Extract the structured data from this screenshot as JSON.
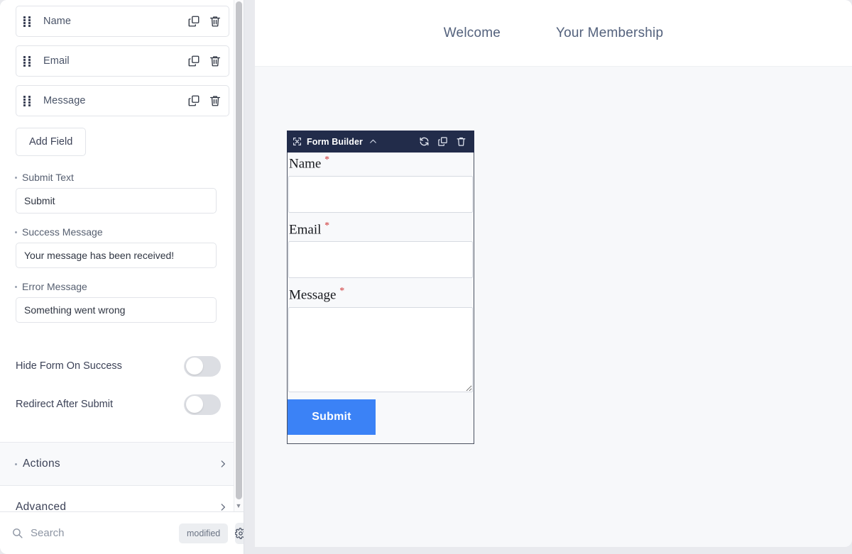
{
  "sidebar": {
    "fields": [
      {
        "label": "Name",
        "drag_icon": "drag-handle-icon",
        "duplicate_icon": "duplicate-icon",
        "delete_icon": "trash-icon"
      },
      {
        "label": "Email",
        "drag_icon": "drag-handle-icon",
        "duplicate_icon": "duplicate-icon",
        "delete_icon": "trash-icon"
      },
      {
        "label": "Message",
        "drag_icon": "drag-handle-icon",
        "duplicate_icon": "duplicate-icon",
        "delete_icon": "trash-icon"
      }
    ],
    "add_field_label": "Add Field",
    "settings": [
      {
        "label": "Submit Text",
        "value": "Submit"
      },
      {
        "label": "Success Message",
        "value": "Your message has been received!"
      },
      {
        "label": "Error Message",
        "value": "Something went wrong"
      }
    ],
    "toggles": [
      {
        "label": "Hide Form On Success",
        "state": "off"
      },
      {
        "label": "Redirect After Submit",
        "state": "off"
      }
    ],
    "sections": [
      {
        "label": "Actions",
        "has_dot": true,
        "chevron": "chevron-right-icon"
      },
      {
        "label": "Advanced",
        "has_dot": false,
        "chevron": "chevron-right-icon"
      }
    ],
    "search": {
      "placeholder": "Search",
      "icon": "search-icon",
      "chip": "modified",
      "gear_icon": "gear-icon"
    }
  },
  "main": {
    "nav": [
      {
        "label": "Welcome"
      },
      {
        "label": "Your Membership"
      }
    ],
    "widget": {
      "title": "Form Builder",
      "move_icon": "move-icon",
      "collapse_icon": "chevron-up-icon",
      "refresh_icon": "refresh-icon",
      "duplicate_icon": "duplicate-icon",
      "delete_icon": "trash-icon",
      "fields": [
        {
          "label": "Name",
          "required_mark": "*",
          "control": "input"
        },
        {
          "label": "Email",
          "required_mark": "*",
          "control": "input"
        },
        {
          "label": "Message",
          "required_mark": "*",
          "control": "textarea"
        }
      ],
      "submit_label": "Submit"
    }
  },
  "colors": {
    "widget_bar": "#222c4a",
    "submit_button": "#3b82f6",
    "required_asterisk": "#cf3434",
    "canvas_bg": "#f7f8fa",
    "nav_link": "#53617c"
  }
}
